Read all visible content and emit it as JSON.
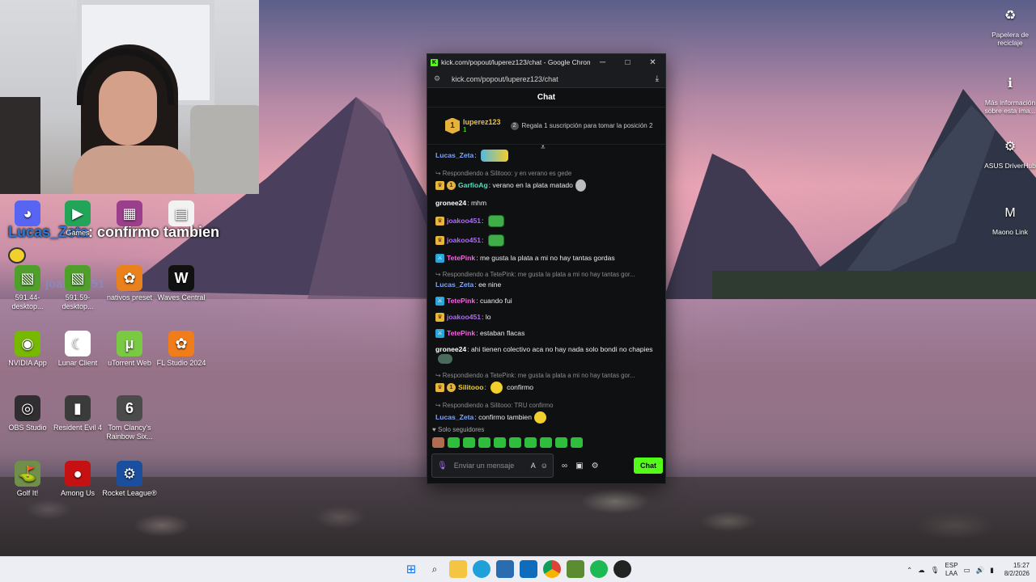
{
  "overlay": {
    "user": "Lucas_Zeta",
    "message": ": confirmo tambien",
    "ghost_user": "joakoo451"
  },
  "desktop_icons": [
    {
      "label": "",
      "color": "#5865f2",
      "glyph": "◕"
    },
    {
      "label": "Games",
      "color": "#22a559",
      "glyph": "▶"
    },
    {
      "label": "",
      "color": "#9b3f8d",
      "glyph": "▦"
    },
    {
      "label": "",
      "color": "#f2f2f2",
      "glyph": "▤"
    },
    {
      "label": "591.44-desktop...",
      "color": "#4fa02a",
      "glyph": "▧"
    },
    {
      "label": "591.59-desktop...",
      "color": "#4fa02a",
      "glyph": "▧"
    },
    {
      "label": "nativos preset",
      "color": "#e9811c",
      "glyph": "✿"
    },
    {
      "label": "Waves Central",
      "color": "#111111",
      "glyph": "W"
    },
    {
      "label": "NVIDIA App",
      "color": "#76b900",
      "glyph": "◉"
    },
    {
      "label": "Lunar Client",
      "color": "#ffffff",
      "glyph": "☾"
    },
    {
      "label": "uTorrent Web",
      "color": "#7ac943",
      "glyph": "μ"
    },
    {
      "label": "FL Studio 2024",
      "color": "#f07d1a",
      "glyph": "✿"
    },
    {
      "label": "OBS Studio",
      "color": "#302e31",
      "glyph": "◎"
    },
    {
      "label": "Resident Evil 4",
      "color": "#3b3b3b",
      "glyph": "▮"
    },
    {
      "label": "Tom Clancy's Rainbow Six...",
      "color": "#4b4b4b",
      "glyph": "6"
    },
    {
      "label": "Golf It!",
      "color": "#6f8f4a",
      "glyph": "⛳"
    },
    {
      "label": "Among Us",
      "color": "#c51111",
      "glyph": "●"
    },
    {
      "label": "Rocket League®",
      "color": "#1a4fa0",
      "glyph": "⚙"
    }
  ],
  "right_icons": [
    {
      "label": "Papelera de reciclaje",
      "glyph": "♻"
    },
    {
      "label": "Más información sobre esta ima...",
      "glyph": "ℹ"
    },
    {
      "label": "ASUS DriverHub",
      "glyph": "⚙"
    },
    {
      "label": "Maono Link",
      "glyph": "M"
    }
  ],
  "chrome": {
    "title": "kick.com/popout/luperez123/chat - Google Chrome",
    "url": "kick.com/popout/luperez123/chat",
    "minimize": "─",
    "maximize": "□",
    "close": "✕"
  },
  "chat": {
    "header": "Chat",
    "pinned": {
      "rank": "1",
      "name": "luperez123",
      "count": "1",
      "position": "2",
      "text": "Regala 1 suscripción para tomar la posición 2"
    },
    "messages": [
      {
        "reply": "",
        "badge": "",
        "user": "Lucas_Zeta",
        "ucls": "u-lucas",
        "text": "",
        "emote": "wide"
      },
      {
        "reply": "Respondiendo a Silitooo: y en verano es gede",
        "badge": "crown+sub",
        "user": "GarfioAg",
        "ucls": "u-garfio",
        "text": "verano en la plata matado",
        "emote": "skull"
      },
      {
        "reply": "",
        "badge": "",
        "user": "gronee24",
        "ucls": "u-gronee",
        "text": "mhm",
        "emote": ""
      },
      {
        "reply": "",
        "badge": "crown",
        "user": "joakoo451",
        "ucls": "u-joakoo",
        "text": "",
        "emote": "green"
      },
      {
        "reply": "",
        "badge": "crown",
        "user": "joakoo451",
        "ucls": "u-joakoo",
        "text": "",
        "emote": "green"
      },
      {
        "reply": "",
        "badge": "sword",
        "user": "TetePink",
        "ucls": "u-tete",
        "text": "me gusta la plata a mi no hay tantas gordas",
        "emote": ""
      },
      {
        "reply": "Respondiendo a TetePink: me gusta la plata a mi no hay tantas gor...",
        "badge": "",
        "user": "Lucas_Zeta",
        "ucls": "u-lucas",
        "text": "ee nine",
        "emote": ""
      },
      {
        "reply": "",
        "badge": "sword",
        "user": "TetePink",
        "ucls": "u-tete",
        "text": "cuando fui",
        "emote": ""
      },
      {
        "reply": "",
        "badge": "crown",
        "user": "joakoo451",
        "ucls": "u-joakoo",
        "text": "lo",
        "emote": ""
      },
      {
        "reply": "",
        "badge": "sword",
        "user": "TetePink",
        "ucls": "u-tete",
        "text": "estaban flacas",
        "emote": ""
      },
      {
        "reply": "",
        "badge": "",
        "user": "gronee24",
        "ucls": "u-gronee",
        "text": "ahi tienen colectivo aca no hay nada solo bondi no chapies",
        "emote": "eyes"
      },
      {
        "reply": "Respondiendo a TetePink: me gusta la plata a mi no hay tantas gor...",
        "badge": "crown+sub",
        "user": "Silitooo",
        "ucls": "u-silitooo",
        "text": "confirmo",
        "emote": "yellow-before"
      },
      {
        "reply": "Respondiendo a Silitooo: TRU confirmo",
        "badge": "",
        "user": "Lucas_Zeta",
        "ucls": "u-lucas",
        "text": "confirmo tambien",
        "emote": "yellow"
      },
      {
        "reply": "",
        "badge": "crown",
        "user": "joakoo451",
        "ucls": "u-joakoo",
        "text": "",
        "emote": "green"
      }
    ],
    "follow_only": "Solo seguidores",
    "input_placeholder": "Enviar un mensaje",
    "send_label": "Chat"
  },
  "taskbar": {
    "lang_top": "ESP",
    "lang_bottom": "LAA",
    "time": "15:27",
    "date": "8/2/2026"
  }
}
